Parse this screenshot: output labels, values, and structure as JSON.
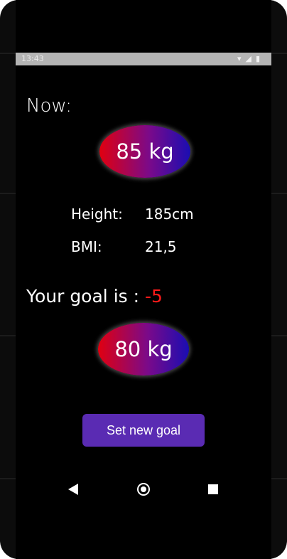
{
  "status_bar": {
    "time": "13:43",
    "icons": [
      "wifi-icon",
      "signal-icon",
      "battery-icon"
    ]
  },
  "current": {
    "label": "Now:",
    "weight": "85 kg"
  },
  "stats": [
    {
      "key": "Height:",
      "value": "185cm"
    },
    {
      "key": "BMI:",
      "value": "21,5"
    }
  ],
  "goal": {
    "prefix": "Your goal is : ",
    "delta": "-5",
    "weight": "80 kg"
  },
  "button": {
    "label": "Set new goal"
  },
  "nav": [
    "back-icon",
    "home-icon",
    "recent-apps-icon"
  ],
  "colors": {
    "accent": "#5a2bb3",
    "delta": "#ff1a1a",
    "oval_start": "#e00010",
    "oval_end": "#1a0db2"
  }
}
